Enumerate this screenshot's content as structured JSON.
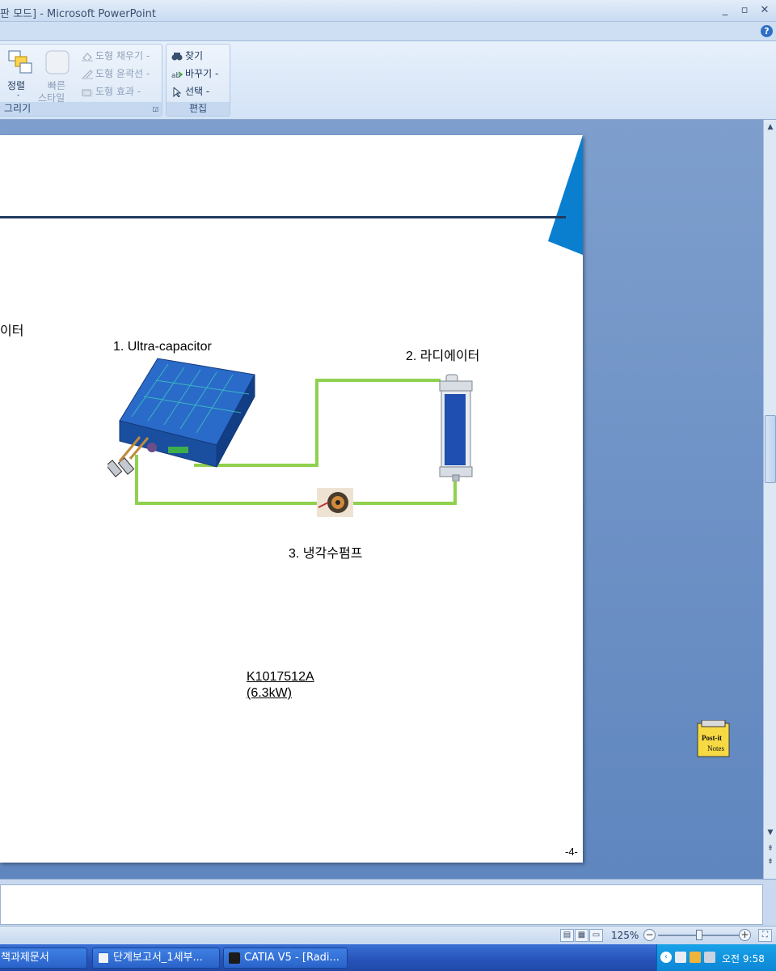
{
  "window": {
    "title": "판 모드] - Microsoft PowerPoint",
    "minimize": "_",
    "restore": "▫",
    "close": "✕"
  },
  "ribbon": {
    "help": "?",
    "arrange": {
      "label": "정렬"
    },
    "quick_styles": {
      "label_line1": "빠른",
      "label_line2": "스타일"
    },
    "shape_fill": "도형 채우기",
    "shape_outline": "도형 윤곽선",
    "shape_effects": "도형 효과",
    "drawing_group": "그리기",
    "find": "찾기",
    "replace": "바꾸기",
    "select": "선택",
    "editing_group": "편집",
    "dropdown_mark": "-"
  },
  "slide": {
    "left_text_fragment": "이터",
    "label_ultracap": "1. Ultra-capacitor",
    "label_radiator": "2. 라디에이터",
    "label_pump": "3. 냉각수펌프",
    "model_line1": "K1017512A",
    "model_line2": "(6.3kW)",
    "page_number": "-4-",
    "accent_color": "#0a7fd0",
    "pipe_color": "#8fd14f"
  },
  "postit": {
    "line1": "Post-it",
    "line2": "Notes"
  },
  "statusbar": {
    "zoom": "125%"
  },
  "taskbar": {
    "items": [
      {
        "label": "책과제문서"
      },
      {
        "label": "단계보고서_1세부..."
      },
      {
        "label": "CATIA V5 - [Radi..."
      }
    ],
    "clock": "오전 9:58"
  }
}
